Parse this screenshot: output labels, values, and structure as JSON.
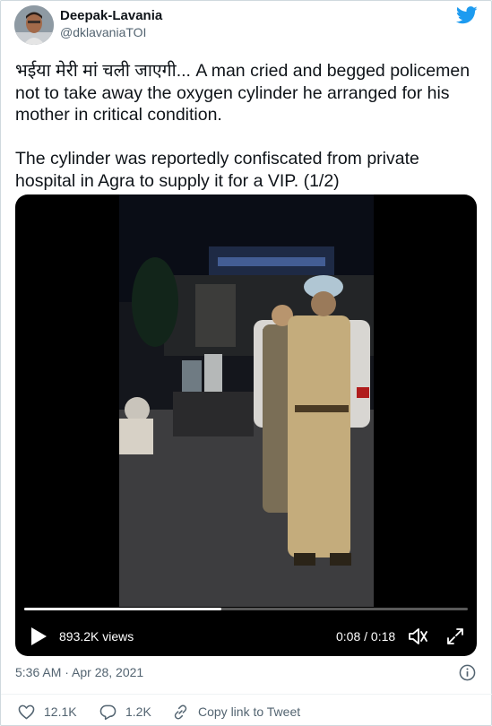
{
  "author": {
    "name": "Deepak-Lavania",
    "handle": "@dklavaniaTOI",
    "avatar_icon": "profile-photo"
  },
  "tweet": {
    "text": "भईया मेरी मां चली जाएगी... A man cried and begged policemen not to take away the oxygen cylinder he arranged for his mother in critical condition.\n\nThe cylinder was reportedly confiscated from private hospital in Agra to supply it for a VIP. (1/2)"
  },
  "video": {
    "views": "893.2K views",
    "time": "0:08 / 0:18",
    "progress": 0.444
  },
  "timestamp": "5:36 AM · Apr 28, 2021",
  "actions": {
    "likes": "12.1K",
    "replies": "1.2K",
    "copy_link": "Copy link to Tweet"
  },
  "colors": {
    "twitter_blue": "#1d9bf0",
    "muted_text": "#536471",
    "main_text": "#0f1419",
    "border": "#cfd9de"
  },
  "icons": [
    "twitter-bird-icon",
    "play-icon",
    "volume-icon",
    "fullscreen-icon",
    "info-icon",
    "heart-icon",
    "reply-icon",
    "link-icon"
  ]
}
